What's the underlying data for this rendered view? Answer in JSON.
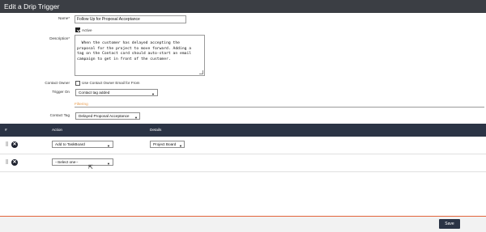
{
  "window": {
    "title": "Edit a Drip Trigger"
  },
  "form": {
    "name_label": "Name*",
    "name_value": "Follow Up for Proposal Acceptance",
    "active_label": "Active",
    "active_checked": true,
    "description_label": "Description*",
    "description_value": "When the customer has delayed accepting the\nproposal for the project to move forward. Adding a\ntag on the Contact card should auto-start an email\ncampaign to get in front of the customer.",
    "contact_owner_label": "Contact Owner",
    "contact_owner_checkbox_label": "Use Contact Owner Email for From",
    "contact_owner_checked": false,
    "trigger_on_label": "Trigger On",
    "trigger_on_value": "Contact tag added"
  },
  "filtering": {
    "section_label": "Filtering",
    "contact_tag_label": "Contact Tag",
    "contact_tag_value": "Delayed Proposal Acceptance"
  },
  "table": {
    "headers": {
      "index": "#",
      "action": "Action",
      "details": "Details"
    },
    "rows": [
      {
        "action": "Add to TaskBoard",
        "details": "Project Board"
      },
      {
        "action": "--Select one--",
        "details": ""
      }
    ]
  },
  "footer": {
    "save_label": "Save"
  },
  "colors": {
    "header_bg": "#2b3445",
    "title_bg": "#3b3e44",
    "accent": "#e2643a",
    "filter_label": "#e89a4a"
  }
}
